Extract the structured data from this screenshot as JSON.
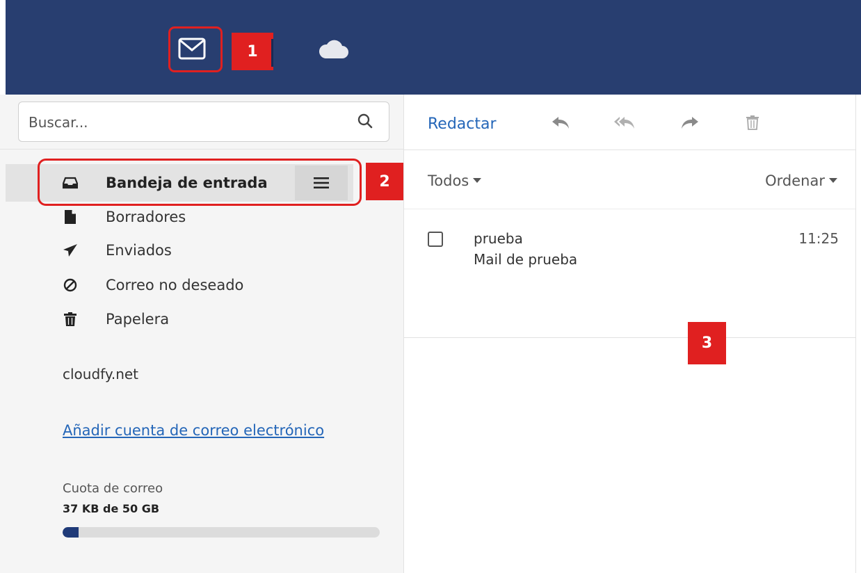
{
  "topbar": {
    "mail_icon": "envelope-icon",
    "cloud_icon": "cloud-icon",
    "background": "#283e70"
  },
  "annotations": {
    "badge1": "1",
    "badge2": "2",
    "badge3": "3",
    "color": "#e02020"
  },
  "sidebar": {
    "search_placeholder": "Buscar...",
    "folders": [
      {
        "label": "Bandeja de entrada",
        "icon": "inbox-icon",
        "active": true
      },
      {
        "label": "Borradores",
        "icon": "draft-file-icon"
      },
      {
        "label": "Enviados",
        "icon": "paper-plane-icon"
      },
      {
        "label": "Correo no deseado",
        "icon": "ban-icon"
      },
      {
        "label": "Papelera",
        "icon": "trash-icon"
      }
    ],
    "account_domain": "cloudfy.net",
    "add_account_link": "Añadir cuenta de correo electrónico",
    "quota": {
      "title": "Cuota de correo",
      "value": "37 KB de 50 GB",
      "fill_fraction": 0.05,
      "fill_color": "#1f3a78"
    }
  },
  "toolbar": {
    "compose_label": "Redactar",
    "icons": [
      "reply-icon",
      "reply-all-icon",
      "forward-icon",
      "trash-icon"
    ],
    "link_color": "#2466b8"
  },
  "list": {
    "filter_label": "Todos",
    "sort_label": "Ordenar",
    "messages": [
      {
        "subject": "prueba",
        "preview": "Mail de prueba",
        "time": "11:25"
      }
    ]
  }
}
